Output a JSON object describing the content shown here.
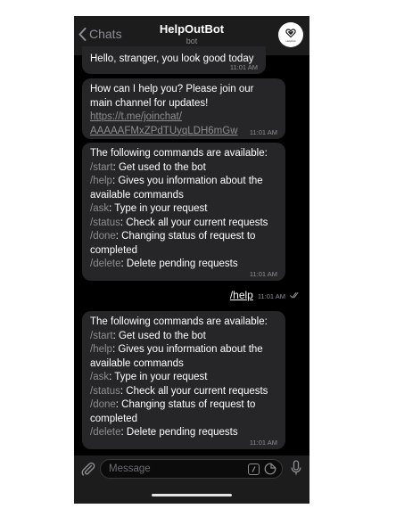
{
  "header": {
    "back_label": "Chats",
    "title": "HelpOutBot",
    "subtitle": "bot",
    "avatar_label": "HelpOut"
  },
  "messages": [
    {
      "lines": [
        "Hello, stranger, you look good today"
      ],
      "time": "11:01 AM"
    },
    {
      "lines": [
        "How can I help you? Please join our",
        "main channel for updates!"
      ],
      "link_lines": [
        "https://t.me/joinchat/",
        "AAAAAFMxZPdTUyqLDH6mGw"
      ],
      "time": "11:01 AM"
    },
    {
      "intro": "The following commands are available:",
      "commands": [
        {
          "cmd": "/start",
          "desc": ": Get used to the bot"
        },
        {
          "cmd": "/help",
          "desc": ": Gives you information about the"
        },
        {
          "cmd": "",
          "desc": "available commands"
        },
        {
          "cmd": "/ask",
          "desc": ": Type in your request"
        },
        {
          "cmd": "/status",
          "desc": ": Check all your current requests"
        },
        {
          "cmd": "/done",
          "desc": ": Changing status of request to"
        },
        {
          "cmd": "",
          "desc": "completed"
        },
        {
          "cmd": "/delete",
          "desc": ": Delete pending requests"
        }
      ],
      "time": "11:01 AM"
    },
    {
      "intro": "The following commands are available:",
      "commands": [
        {
          "cmd": "/start",
          "desc": ": Get used to the bot"
        },
        {
          "cmd": "/help",
          "desc": ": Gives you information about the"
        },
        {
          "cmd": "",
          "desc": "available commands"
        },
        {
          "cmd": "/ask",
          "desc": ": Type in your request"
        },
        {
          "cmd": "/status",
          "desc": ": Check all your current requests"
        },
        {
          "cmd": "/done",
          "desc": ": Changing status of request to"
        },
        {
          "cmd": "",
          "desc": "completed"
        },
        {
          "cmd": "/delete",
          "desc": ": Delete pending requests"
        }
      ],
      "time": "11:01 AM"
    }
  ],
  "outgoing": {
    "text": "/help",
    "time": "11:01 AM",
    "status_icon": "double-check-icon"
  },
  "composer": {
    "placeholder": "Message",
    "attach_icon": "paperclip-icon",
    "command_icon": "slash-command-icon",
    "sticker_icon": "sticker-icon",
    "mic_icon": "microphone-icon"
  }
}
